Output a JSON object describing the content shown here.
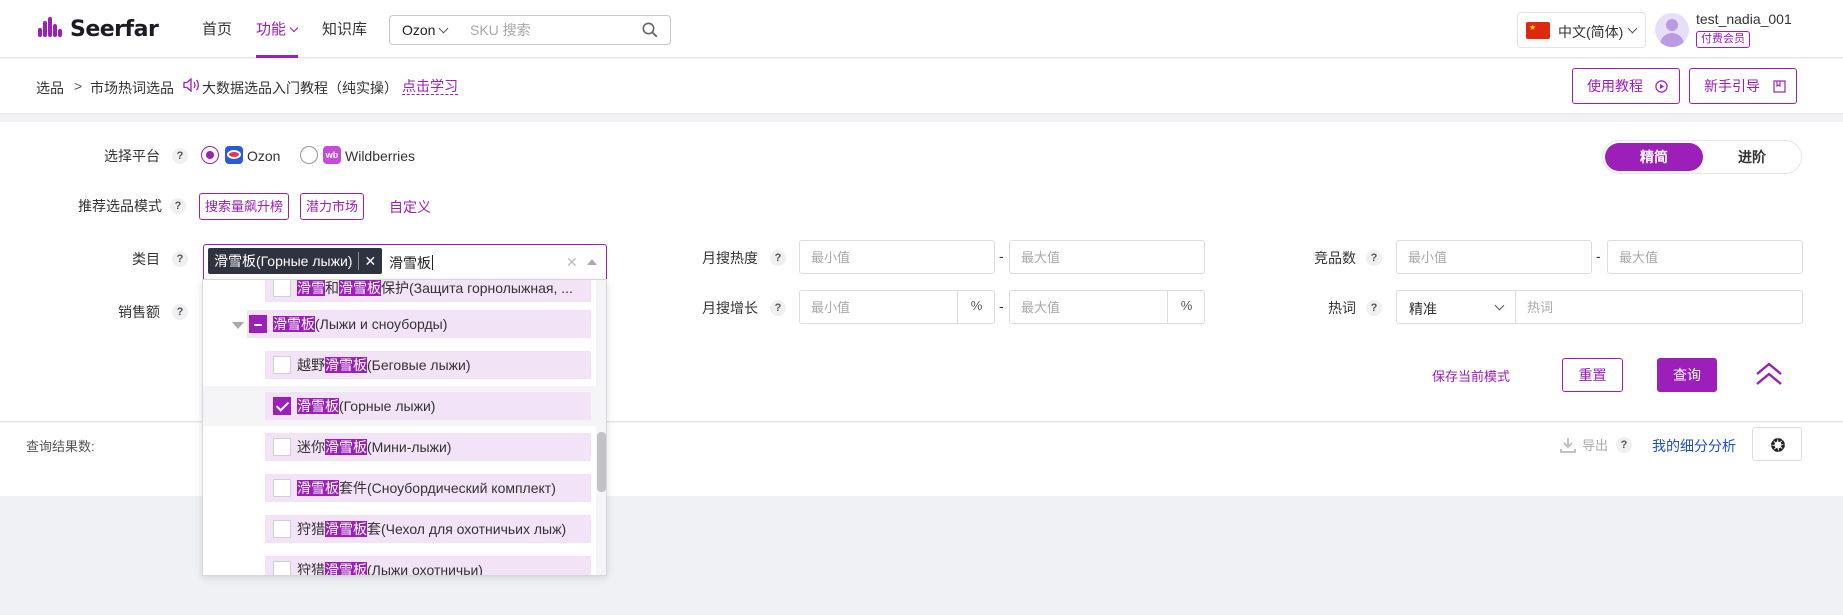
{
  "nav": {
    "logo": "Seerfar",
    "items": [
      "首页",
      "功能",
      "知识库"
    ],
    "search_platform": "Ozon",
    "search_placeholder": "SKU 搜索",
    "language": "中文(简体)",
    "username": "test_nadia_001",
    "member_badge": "付费会员"
  },
  "breadcrumb": {
    "items": [
      "选品",
      "市场热词选品"
    ],
    "separator": ">",
    "tutorial": "大数据选品入门教程（纯实操）",
    "learn_link": "点击学习"
  },
  "top_buttons": {
    "tutorial": "使用教程",
    "guide": "新手引导"
  },
  "filters": {
    "platform_label": "选择平台",
    "platforms": [
      "Ozon",
      "Wildberries"
    ],
    "mode_toggle": [
      "精简",
      "进阶"
    ],
    "recommend_label": "推荐选品模式",
    "recommend_tags": [
      "搜索量飙升榜",
      "潜力市场"
    ],
    "custom_link": "自定义",
    "category_label": "类目",
    "sales_label": "销售额",
    "monthly_search_label": "月搜热度",
    "monthly_growth_label": "月搜增长",
    "competitor_label": "竞品数",
    "hotword_label": "热词",
    "min_placeholder": "最小值",
    "max_placeholder": "最大值",
    "percent_unit": "%",
    "range_dash": "-",
    "hotword_match": "精准",
    "hotword_placeholder": "热词",
    "help_glyph": "?",
    "save_mode": "保存当前模式",
    "reset": "重置",
    "query": "查询"
  },
  "category_select": {
    "selected_tag": "滑雪板(Горные лыжи)",
    "query": "滑雪板",
    "options": [
      {
        "pre": "",
        "hl": "滑雪",
        "mid": "和",
        "hl2": "滑雪板",
        "post": "保护(Защита горнолыжная, ...",
        "state": "off"
      },
      {
        "pre": "",
        "hl": "滑雪板",
        "mid": "",
        "hl2": "",
        "post": "(Лыжи и сноуборды)",
        "state": "half"
      },
      {
        "pre": "越野",
        "hl": "滑雪板",
        "mid": "",
        "hl2": "",
        "post": "(Беговые лыжи)",
        "state": "off"
      },
      {
        "pre": "",
        "hl": "滑雪板",
        "mid": "",
        "hl2": "",
        "post": "(Горные лыжи)",
        "state": "on"
      },
      {
        "pre": "迷你",
        "hl": "滑雪板",
        "mid": "",
        "hl2": "",
        "post": "(Мини-лыжи)",
        "state": "off"
      },
      {
        "pre": "",
        "hl": "滑雪板",
        "mid": "",
        "hl2": "",
        "post": "套件(Сноубордический комплект)",
        "state": "off"
      },
      {
        "pre": "狩猎",
        "hl": "滑雪板",
        "mid": "",
        "hl2": "",
        "post": "套(Чехол для охотничьих лыж)",
        "state": "off"
      },
      {
        "pre": "狩猎",
        "hl": "滑雪板",
        "mid": "",
        "hl2": "",
        "post": "(Лыжи охотничьи)",
        "state": "off"
      }
    ]
  },
  "results": {
    "count_label": "查询结果数:",
    "export": "导出",
    "analysis": "我的细分分析"
  },
  "colors": {
    "accent": "#9b1fb8",
    "highlight_bg": "#f3e3f6",
    "tag_bg": "#2f3340",
    "link_blue": "#1f4fbf"
  }
}
